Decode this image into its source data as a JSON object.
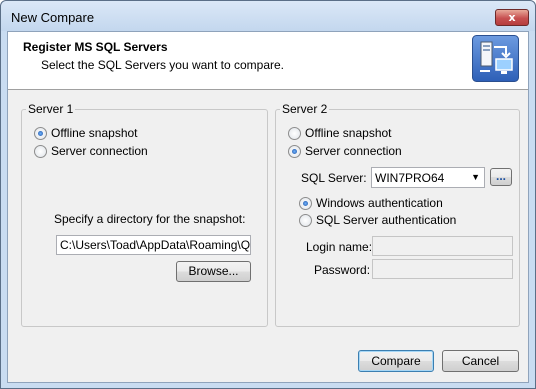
{
  "window": {
    "title": "New Compare",
    "close_glyph": "x"
  },
  "header": {
    "title": "Register MS SQL Servers",
    "subtitle": "Select the SQL Servers you want to compare.",
    "icon": "server-connection-icon"
  },
  "server1": {
    "group_title": "Server 1",
    "offline_snapshot_label": "Offline snapshot",
    "offline_snapshot_selected": true,
    "server_connection_label": "Server connection",
    "server_connection_selected": false,
    "directory_label": "Specify a directory for the snapshot:",
    "directory_value": "C:\\Users\\Toad\\AppData\\Roaming\\Quest",
    "browse_label": "Browse..."
  },
  "server2": {
    "group_title": "Server 2",
    "offline_snapshot_label": "Offline snapshot",
    "offline_snapshot_selected": false,
    "server_connection_label": "Server connection",
    "server_connection_selected": true,
    "sql_server_label": "SQL Server:",
    "sql_server_value": "WIN7PRO64",
    "ellipsis_label": "...",
    "windows_auth_label": "Windows authentication",
    "windows_auth_selected": true,
    "sql_auth_label": "SQL Server authentication",
    "sql_auth_selected": false,
    "login_label": "Login name:",
    "login_value": "",
    "password_label": "Password:",
    "password_value": ""
  },
  "footer": {
    "compare_label": "Compare",
    "cancel_label": "Cancel"
  }
}
